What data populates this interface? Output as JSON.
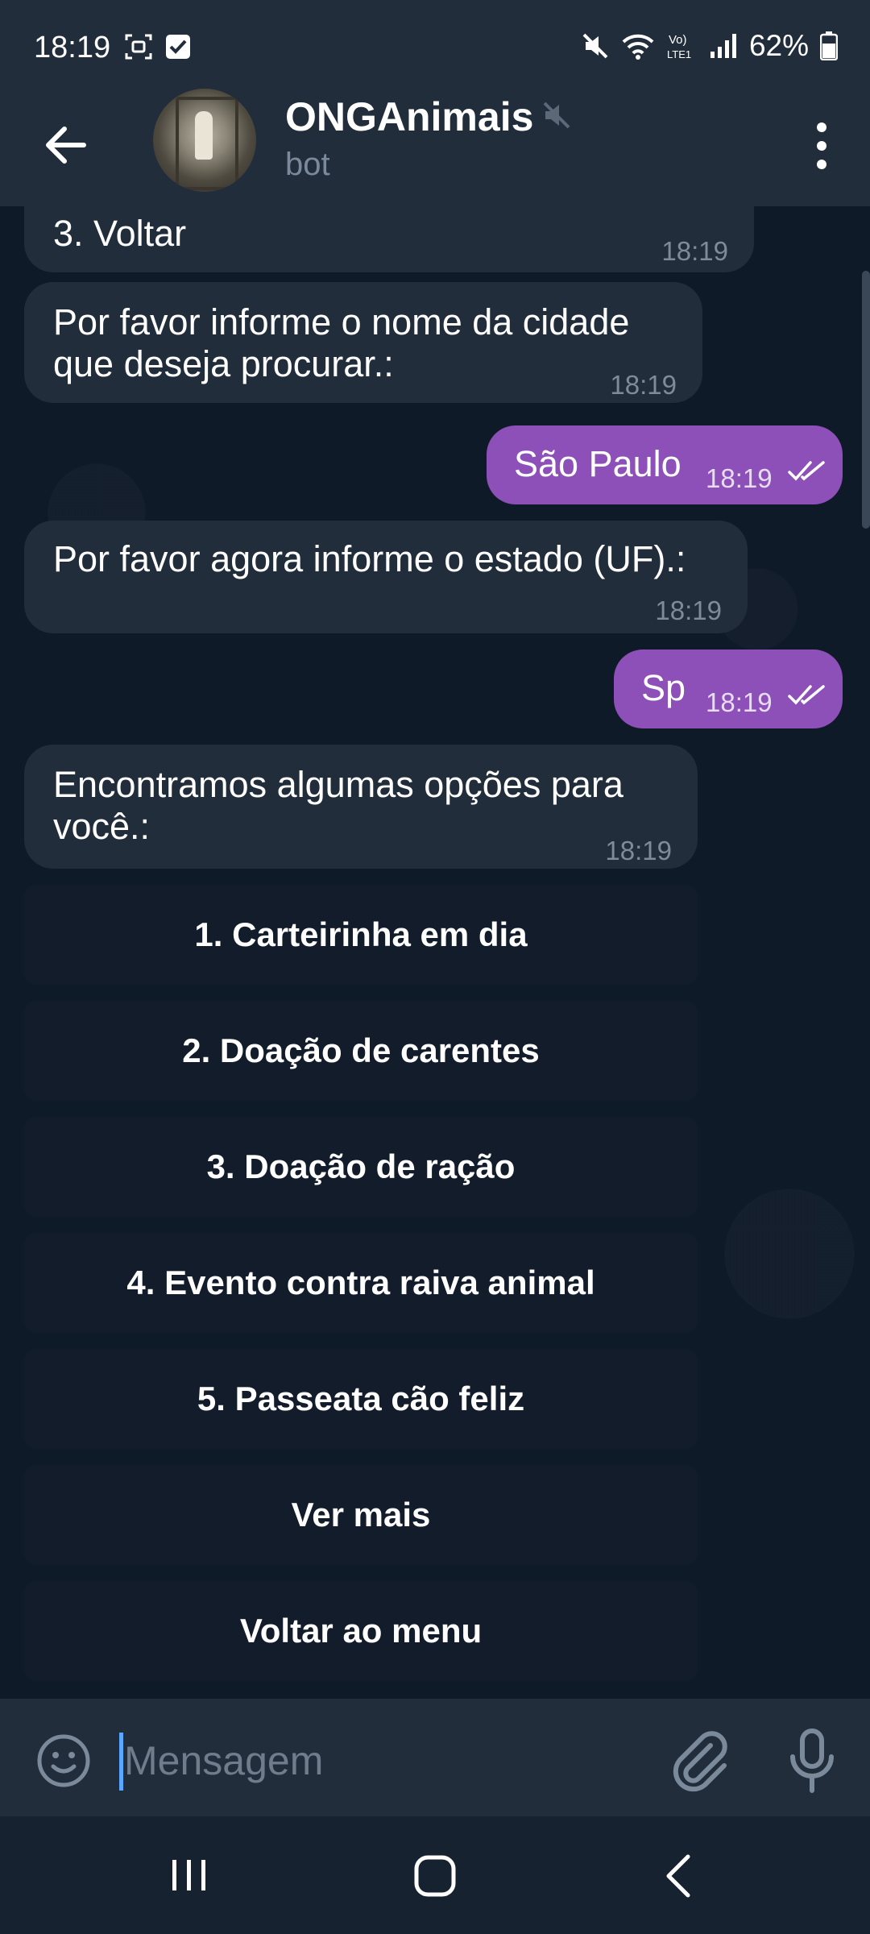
{
  "status_bar": {
    "time": "18:19",
    "battery": "62%"
  },
  "header": {
    "title": "ONGAnimais",
    "subtitle": "bot"
  },
  "messages": [
    {
      "dir": "in",
      "text": "3. Voltar",
      "time": "18:19"
    },
    {
      "dir": "in",
      "lines": [
        "Por favor informe o nome da cidade",
        "que deseja procurar.:"
      ],
      "time": "18:19"
    },
    {
      "dir": "out",
      "text": "São Paulo",
      "time": "18:19"
    },
    {
      "dir": "in",
      "text": "Por favor agora informe o estado (UF).:",
      "time": "18:19"
    },
    {
      "dir": "out",
      "text": "Sp",
      "time": "18:19"
    },
    {
      "dir": "in",
      "lines": [
        "Encontramos algumas opções para",
        "você.:"
      ],
      "time": "18:19"
    }
  ],
  "keyboard": [
    "1. Carteirinha em dia",
    "2. Doação de carentes",
    "3. Doação de ração",
    "4. Evento contra raiva animal",
    "5. Passeata cão feliz",
    "Ver mais",
    "Voltar ao menu"
  ],
  "input": {
    "placeholder": "Mensagem"
  },
  "colors": {
    "accent_outgoing": "#8d4fb8",
    "incoming": "#212d3b",
    "background": "#0f1a29"
  }
}
